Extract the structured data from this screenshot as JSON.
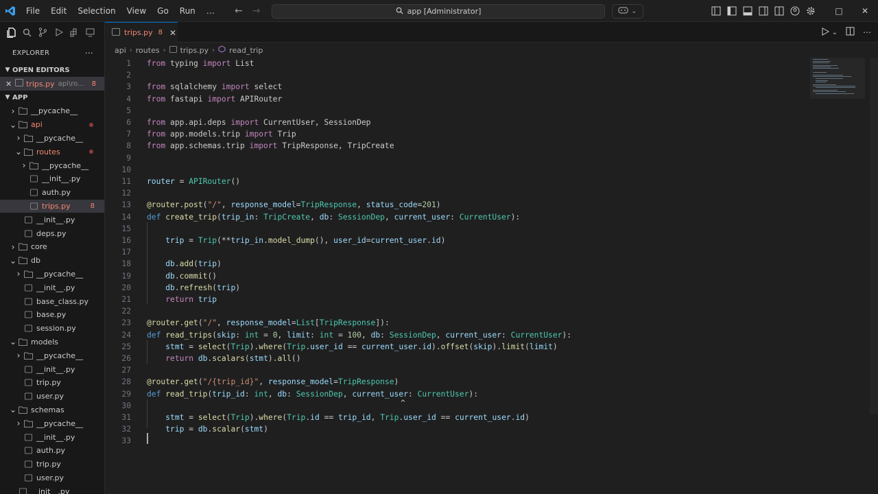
{
  "titlebar": {
    "menu": [
      "File",
      "Edit",
      "Selection",
      "View",
      "Go",
      "Run",
      "…"
    ],
    "search_text": "app [Administrator]"
  },
  "sidebar": {
    "explorer_title": "EXPLORER",
    "open_editors_label": "OPEN EDITORS",
    "open_editor": {
      "name": "trips.py",
      "path": "api\\ro...",
      "count": "8"
    },
    "root_label": "APP",
    "tree": [
      {
        "label": "__pycache__",
        "type": "folder",
        "indent": 1,
        "expanded": false
      },
      {
        "label": "api",
        "type": "folder",
        "indent": 1,
        "expanded": true,
        "error": true
      },
      {
        "label": "__pycache__",
        "type": "folder",
        "indent": 2,
        "expanded": false
      },
      {
        "label": "routes",
        "type": "folder",
        "indent": 2,
        "expanded": true,
        "error": true
      },
      {
        "label": "__pycache__",
        "type": "folder",
        "indent": 3,
        "expanded": false
      },
      {
        "label": "__init__.py",
        "type": "file",
        "indent": 3
      },
      {
        "label": "auth.py",
        "type": "file",
        "indent": 3
      },
      {
        "label": "trips.py",
        "type": "file",
        "indent": 3,
        "error": true,
        "count": "8",
        "selected": true
      },
      {
        "label": "__init__.py",
        "type": "file",
        "indent": 2
      },
      {
        "label": "deps.py",
        "type": "file",
        "indent": 2
      },
      {
        "label": "core",
        "type": "folder",
        "indent": 1,
        "expanded": false
      },
      {
        "label": "db",
        "type": "folder",
        "indent": 1,
        "expanded": true
      },
      {
        "label": "__pycache__",
        "type": "folder",
        "indent": 2,
        "expanded": false
      },
      {
        "label": "__init__.py",
        "type": "file",
        "indent": 2
      },
      {
        "label": "base_class.py",
        "type": "file",
        "indent": 2
      },
      {
        "label": "base.py",
        "type": "file",
        "indent": 2
      },
      {
        "label": "session.py",
        "type": "file",
        "indent": 2
      },
      {
        "label": "models",
        "type": "folder",
        "indent": 1,
        "expanded": true
      },
      {
        "label": "__pycache__",
        "type": "folder",
        "indent": 2,
        "expanded": false
      },
      {
        "label": "__init__.py",
        "type": "file",
        "indent": 2
      },
      {
        "label": "trip.py",
        "type": "file",
        "indent": 2
      },
      {
        "label": "user.py",
        "type": "file",
        "indent": 2
      },
      {
        "label": "schemas",
        "type": "folder",
        "indent": 1,
        "expanded": true
      },
      {
        "label": "__pycache__",
        "type": "folder",
        "indent": 2,
        "expanded": false
      },
      {
        "label": "__init__.py",
        "type": "file",
        "indent": 2
      },
      {
        "label": "auth.py",
        "type": "file",
        "indent": 2
      },
      {
        "label": "trip.py",
        "type": "file",
        "indent": 2
      },
      {
        "label": "user.py",
        "type": "file",
        "indent": 2
      },
      {
        "label": "__init__.py",
        "type": "file",
        "indent": 1
      }
    ]
  },
  "tab": {
    "name": "trips.py",
    "count": "8"
  },
  "breadcrumb": [
    "api",
    "routes",
    "trips.py",
    "read_trip"
  ],
  "code": [
    [
      [
        "kw",
        "from"
      ],
      [
        "t",
        " typing "
      ],
      [
        "kw",
        "import"
      ],
      [
        "t",
        " List"
      ]
    ],
    [],
    [
      [
        "kw",
        "from"
      ],
      [
        "t",
        " sqlalchemy "
      ],
      [
        "kw",
        "import"
      ],
      [
        "t",
        " select"
      ]
    ],
    [
      [
        "kw",
        "from"
      ],
      [
        "t",
        " fastapi "
      ],
      [
        "kw",
        "import"
      ],
      [
        "t",
        " APIRouter"
      ]
    ],
    [],
    [
      [
        "kw",
        "from"
      ],
      [
        "t",
        " app.api.deps "
      ],
      [
        "kw",
        "import"
      ],
      [
        "t",
        " CurrentUser, SessionDep"
      ]
    ],
    [
      [
        "kw",
        "from"
      ],
      [
        "t",
        " app.models.trip "
      ],
      [
        "kw",
        "import"
      ],
      [
        "t",
        " Trip"
      ]
    ],
    [
      [
        "kw",
        "from"
      ],
      [
        "t",
        " app.schemas.trip "
      ],
      [
        "kw",
        "import"
      ],
      [
        "t",
        " TripResponse, TripCreate"
      ]
    ],
    [],
    [],
    [
      [
        "var",
        "router"
      ],
      [
        "t",
        " = "
      ],
      [
        "cls",
        "APIRouter"
      ],
      [
        "t",
        "()"
      ]
    ],
    [],
    [
      [
        "fn",
        "@router.post"
      ],
      [
        "t",
        "("
      ],
      [
        "str",
        "\"/\""
      ],
      [
        "t",
        ", "
      ],
      [
        "var",
        "response_model"
      ],
      [
        "t",
        "="
      ],
      [
        "cls",
        "TripResponse"
      ],
      [
        "t",
        ", "
      ],
      [
        "var",
        "status_code"
      ],
      [
        "t",
        "="
      ],
      [
        "num2",
        "201"
      ],
      [
        "t",
        ")"
      ]
    ],
    [
      [
        "kw2",
        "def"
      ],
      [
        "t",
        " "
      ],
      [
        "fn",
        "create_trip"
      ],
      [
        "t",
        "("
      ],
      [
        "var",
        "trip_in"
      ],
      [
        "t",
        ": "
      ],
      [
        "cls",
        "TripCreate"
      ],
      [
        "t",
        ", "
      ],
      [
        "var",
        "db"
      ],
      [
        "t",
        ": "
      ],
      [
        "cls",
        "SessionDep"
      ],
      [
        "t",
        ", "
      ],
      [
        "var",
        "current_user"
      ],
      [
        "t",
        ": "
      ],
      [
        "cls",
        "CurrentUser"
      ],
      [
        "t",
        "):"
      ]
    ],
    [],
    [
      [
        "t",
        "    "
      ],
      [
        "var",
        "trip"
      ],
      [
        "t",
        " = "
      ],
      [
        "cls",
        "Trip"
      ],
      [
        "t",
        "(**"
      ],
      [
        "var",
        "trip_in"
      ],
      [
        "t",
        "."
      ],
      [
        "fn",
        "model_dump"
      ],
      [
        "t",
        "(), "
      ],
      [
        "var",
        "user_id"
      ],
      [
        "t",
        "="
      ],
      [
        "var",
        "current_user"
      ],
      [
        "t",
        "."
      ],
      [
        "var",
        "id"
      ],
      [
        "t",
        ")"
      ]
    ],
    [],
    [
      [
        "t",
        "    "
      ],
      [
        "var",
        "db"
      ],
      [
        "t",
        "."
      ],
      [
        "fn",
        "add"
      ],
      [
        "t",
        "("
      ],
      [
        "var",
        "trip"
      ],
      [
        "t",
        ")"
      ]
    ],
    [
      [
        "t",
        "    "
      ],
      [
        "var",
        "db"
      ],
      [
        "t",
        "."
      ],
      [
        "fn",
        "commit"
      ],
      [
        "t",
        "()"
      ]
    ],
    [
      [
        "t",
        "    "
      ],
      [
        "var",
        "db"
      ],
      [
        "t",
        "."
      ],
      [
        "fn",
        "refresh"
      ],
      [
        "t",
        "("
      ],
      [
        "var",
        "trip"
      ],
      [
        "t",
        ")"
      ]
    ],
    [
      [
        "t",
        "    "
      ],
      [
        "kw",
        "return"
      ],
      [
        "t",
        " "
      ],
      [
        "var",
        "trip"
      ]
    ],
    [],
    [
      [
        "fn",
        "@router.get"
      ],
      [
        "t",
        "("
      ],
      [
        "str",
        "\"/\""
      ],
      [
        "t",
        ", "
      ],
      [
        "var",
        "response_model"
      ],
      [
        "t",
        "="
      ],
      [
        "cls",
        "List"
      ],
      [
        "t",
        "["
      ],
      [
        "cls",
        "TripResponse"
      ],
      [
        "t",
        "]):"
      ]
    ],
    [
      [
        "kw2",
        "def"
      ],
      [
        "t",
        " "
      ],
      [
        "fn",
        "read_trips"
      ],
      [
        "t",
        "("
      ],
      [
        "var",
        "skip"
      ],
      [
        "t",
        ": "
      ],
      [
        "cls",
        "int"
      ],
      [
        "t",
        " = "
      ],
      [
        "num2",
        "0"
      ],
      [
        "t",
        ", "
      ],
      [
        "var",
        "limit"
      ],
      [
        "t",
        ": "
      ],
      [
        "cls",
        "int"
      ],
      [
        "t",
        " = "
      ],
      [
        "num2",
        "100"
      ],
      [
        "t",
        ", "
      ],
      [
        "var",
        "db"
      ],
      [
        "t",
        ": "
      ],
      [
        "cls",
        "SessionDep"
      ],
      [
        "t",
        ", "
      ],
      [
        "var",
        "current_user"
      ],
      [
        "t",
        ": "
      ],
      [
        "cls",
        "CurrentUser"
      ],
      [
        "t",
        "):"
      ]
    ],
    [
      [
        "t",
        "    "
      ],
      [
        "var",
        "stmt"
      ],
      [
        "t",
        " = "
      ],
      [
        "fn",
        "select"
      ],
      [
        "t",
        "("
      ],
      [
        "cls",
        "Trip"
      ],
      [
        "t",
        ")."
      ],
      [
        "fn",
        "where"
      ],
      [
        "t",
        "("
      ],
      [
        "cls",
        "Trip"
      ],
      [
        "t",
        "."
      ],
      [
        "var",
        "user_id"
      ],
      [
        "t",
        " == "
      ],
      [
        "var",
        "current_user"
      ],
      [
        "t",
        "."
      ],
      [
        "var",
        "id"
      ],
      [
        "t",
        ")."
      ],
      [
        "fn",
        "offset"
      ],
      [
        "t",
        "("
      ],
      [
        "var",
        "skip"
      ],
      [
        "t",
        ")."
      ],
      [
        "fn",
        "limit"
      ],
      [
        "t",
        "("
      ],
      [
        "var",
        "limit"
      ],
      [
        "t",
        ")"
      ]
    ],
    [
      [
        "t",
        "    "
      ],
      [
        "kw",
        "return"
      ],
      [
        "t",
        " "
      ],
      [
        "var",
        "db"
      ],
      [
        "t",
        "."
      ],
      [
        "fn",
        "scalars"
      ],
      [
        "t",
        "("
      ],
      [
        "var",
        "stmt"
      ],
      [
        "t",
        ")."
      ],
      [
        "fn",
        "all"
      ],
      [
        "t",
        "()"
      ]
    ],
    [],
    [
      [
        "fn",
        "@router.get"
      ],
      [
        "t",
        "("
      ],
      [
        "str",
        "\"/{trip_id}\""
      ],
      [
        "t",
        ", "
      ],
      [
        "var",
        "response_model"
      ],
      [
        "t",
        "="
      ],
      [
        "cls",
        "TripResponse"
      ],
      [
        "t",
        ")"
      ]
    ],
    [
      [
        "kw2",
        "def"
      ],
      [
        "t",
        " "
      ],
      [
        "fn",
        "read_trip"
      ],
      [
        "t",
        "("
      ],
      [
        "var",
        "trip_id"
      ],
      [
        "t",
        ": "
      ],
      [
        "cls",
        "int"
      ],
      [
        "t",
        ", "
      ],
      [
        "var",
        "db"
      ],
      [
        "t",
        ": "
      ],
      [
        "cls",
        "SessionDep"
      ],
      [
        "t",
        ", "
      ],
      [
        "var",
        "current_user"
      ],
      [
        "t",
        ": "
      ],
      [
        "cls",
        "CurrentUser"
      ],
      [
        "t",
        "):"
      ]
    ],
    [],
    [
      [
        "t",
        "    "
      ],
      [
        "var",
        "stmt"
      ],
      [
        "t",
        " = "
      ],
      [
        "fn",
        "select"
      ],
      [
        "t",
        "("
      ],
      [
        "cls",
        "Trip"
      ],
      [
        "t",
        ")."
      ],
      [
        "fn",
        "where"
      ],
      [
        "t",
        "("
      ],
      [
        "cls",
        "Trip"
      ],
      [
        "t",
        "."
      ],
      [
        "var",
        "id"
      ],
      [
        "t",
        " == "
      ],
      [
        "var",
        "trip_id"
      ],
      [
        "t",
        ", "
      ],
      [
        "cls",
        "Trip"
      ],
      [
        "t",
        "."
      ],
      [
        "var",
        "user_id"
      ],
      [
        "t",
        " == "
      ],
      [
        "var",
        "current_user"
      ],
      [
        "t",
        "."
      ],
      [
        "var",
        "id"
      ],
      [
        "t",
        ")"
      ]
    ],
    [
      [
        "t",
        "    "
      ],
      [
        "var",
        "trip"
      ],
      [
        "t",
        " = "
      ],
      [
        "var",
        "db"
      ],
      [
        "t",
        "."
      ],
      [
        "fn",
        "scalar"
      ],
      [
        "t",
        "("
      ],
      [
        "var",
        "stmt"
      ],
      [
        "t",
        ")"
      ]
    ],
    []
  ],
  "colors": {
    "accent": "#0078d4",
    "error": "#f48771",
    "background": "#1f1f1f",
    "sidebar": "#181818"
  }
}
